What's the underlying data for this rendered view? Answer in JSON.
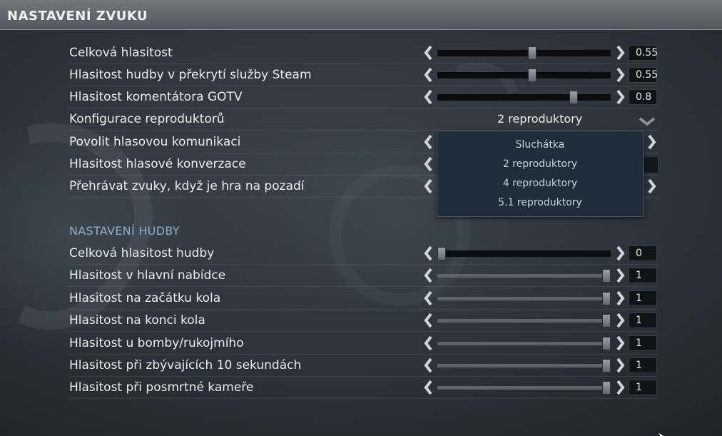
{
  "header": {
    "title": "NASTAVENÍ ZVUKU"
  },
  "audio_rows": [
    {
      "label": "Celková hlasitost",
      "value": "0.55",
      "level": 0.55
    },
    {
      "label": "Hlasitost hudby v překrytí služby Steam",
      "value": "0.55",
      "level": 0.55
    },
    {
      "label": "Hlasitost komentátora GOTV",
      "value": "0.8",
      "level": 0.8
    }
  ],
  "speaker_config": {
    "label": "Konfigurace reproduktorů",
    "selected": "2 reproduktory",
    "options": [
      "Sluchátka",
      "2 reproduktory",
      "4 reproduktory",
      "5.1 reproduktory"
    ]
  },
  "covered_rows": [
    {
      "label": "Povolit hlasovou komunikaci"
    },
    {
      "label": "Hlasitost hlasové konverzace"
    },
    {
      "label": "Přehrávat zvuky, když je hra na pozadí"
    }
  ],
  "music_section": {
    "title": "NASTAVENÍ HUDBY"
  },
  "music_rows": [
    {
      "label": "Celková hlasitost hudby",
      "value": "0",
      "level": 0
    },
    {
      "label": "Hlasitost v hlavní nabídce",
      "value": "1",
      "level": 1
    },
    {
      "label": "Hlasitost na začátku kola",
      "value": "1",
      "level": 1
    },
    {
      "label": "Hlasitost na konci kola",
      "value": "1",
      "level": 1
    },
    {
      "label": "Hlasitost u bomby/rukojmího",
      "value": "1",
      "level": 1
    },
    {
      "label": "Hlasitost při zbývajících 10 sekundách",
      "value": "1",
      "level": 1
    },
    {
      "label": "Hlasitost při posmrtné kameře",
      "value": "1",
      "level": 1
    }
  ],
  "icons": {
    "left": "chevron-left-icon",
    "right": "chevron-right-icon",
    "dropdown": "chevron-down-icon",
    "cursor": "mouse-pointer-icon"
  },
  "colors": {
    "section_title": "#8fb0c6",
    "dropdown_bg": "#1f2c39",
    "track": "#0a0c0e"
  }
}
